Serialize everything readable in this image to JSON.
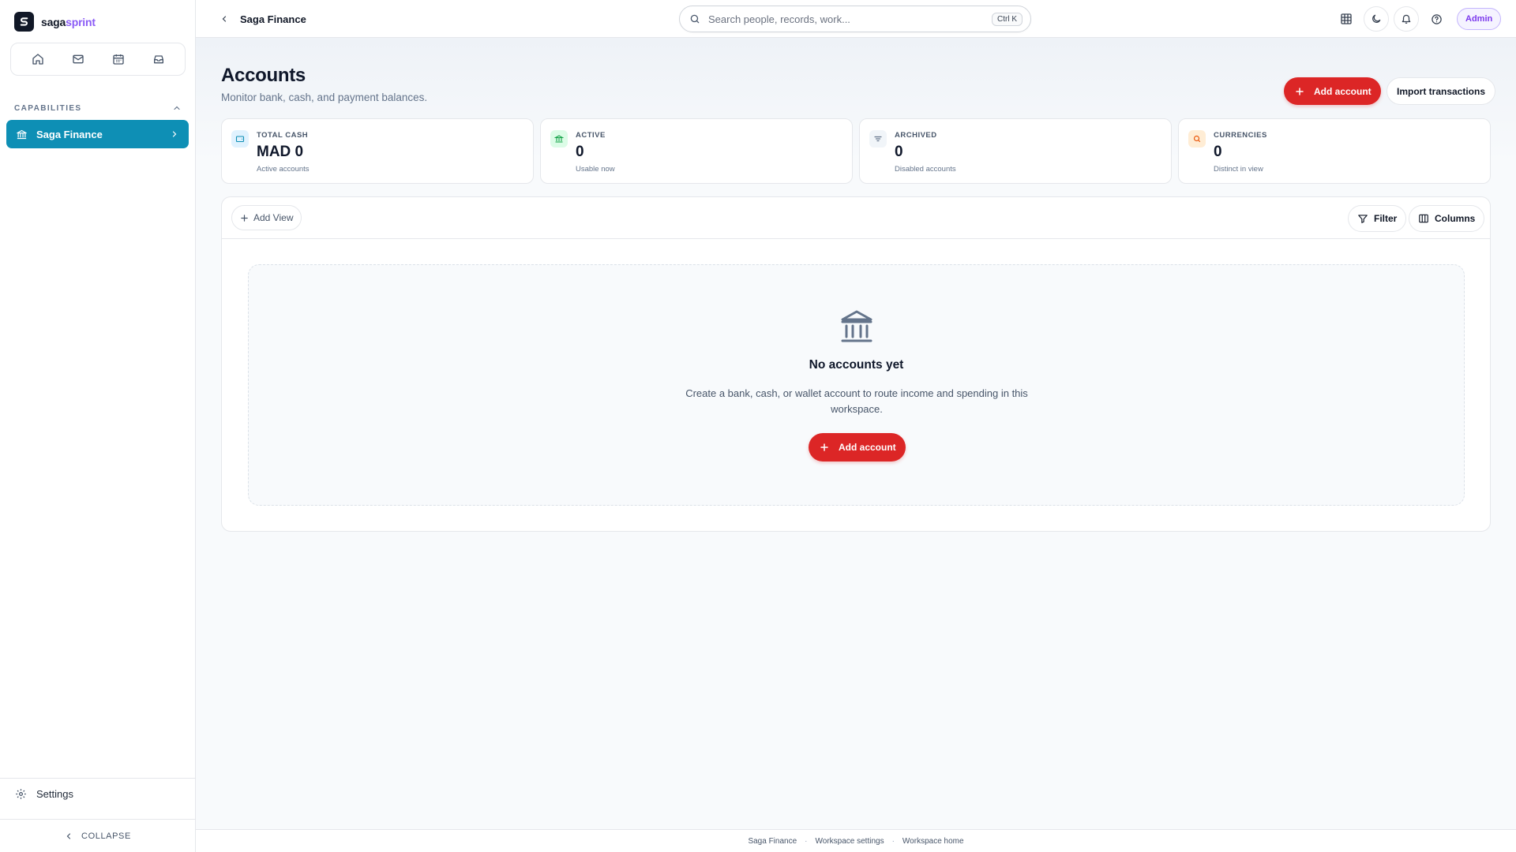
{
  "brand": {
    "name_part1": "saga",
    "name_part2": "sprint",
    "logo_letter": "S"
  },
  "sidebar": {
    "quick_actions": [
      {
        "icon": "home-icon"
      },
      {
        "icon": "mail-icon"
      },
      {
        "icon": "calendar-icon"
      },
      {
        "icon": "inbox-icon"
      }
    ],
    "section_title": "CAPABILITIES",
    "active_item": {
      "label": "Saga Finance",
      "icon": "bank-icon"
    },
    "settings_label": "Settings",
    "collapse_label": "COLLAPSE"
  },
  "topbar": {
    "breadcrumb_title": "Saga Finance",
    "search_placeholder": "Search people, records, work...",
    "search_shortcut": "Ctrl K",
    "admin_label": "Admin"
  },
  "page": {
    "title": "Accounts",
    "subtitle": "Monitor bank, cash, and payment balances.",
    "add_account_label": "Add account",
    "import_label": "Import transactions"
  },
  "stats": [
    {
      "label": "TOTAL CASH",
      "value": "MAD 0",
      "hint": "Active accounts",
      "icon": "wallet-icon",
      "color": "#0e8fb5",
      "bg": "#e0f2fe"
    },
    {
      "label": "ACTIVE",
      "value": "0",
      "hint": "Usable now",
      "icon": "bank-icon",
      "color": "#16a34a",
      "bg": "#dcfce7"
    },
    {
      "label": "ARCHIVED",
      "value": "0",
      "hint": "Disabled accounts",
      "icon": "filter-lines-icon",
      "color": "#64748b",
      "bg": "#f1f5f9"
    },
    {
      "label": "CURRENCIES",
      "value": "0",
      "hint": "Distinct in view",
      "icon": "search-icon",
      "color": "#ea580c",
      "bg": "#ffedd5"
    }
  ],
  "toolbar": {
    "add_view_label": "Add View",
    "filter_label": "Filter",
    "columns_label": "Columns"
  },
  "empty_state": {
    "title": "No accounts yet",
    "description": "Create a bank, cash, or wallet account to route income and spending in this workspace.",
    "button_label": "Add account"
  },
  "footer": {
    "links": [
      "Saga Finance",
      "Workspace settings",
      "Workspace home"
    ]
  },
  "colors": {
    "accent": "#0e8fb5",
    "primary_red": "#dc2626",
    "brand_purple": "#8b5cf6"
  }
}
